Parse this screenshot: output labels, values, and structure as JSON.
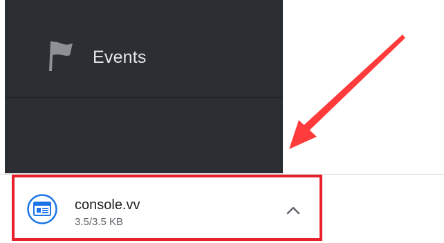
{
  "sidebar": {
    "items": [
      {
        "label": "Events",
        "icon": "flag-icon"
      }
    ]
  },
  "download_bar": {
    "item": {
      "file_name": "console.vv",
      "progress_text": "3.5/3.5 KB",
      "progress": 1.0,
      "icon": "file-icon",
      "menu_icon": "chevron-up-icon"
    }
  },
  "colors": {
    "sidebar_bg": "#2b2e33",
    "highlight": "#e8202a",
    "file_icon_accent": "#1a73e8"
  }
}
